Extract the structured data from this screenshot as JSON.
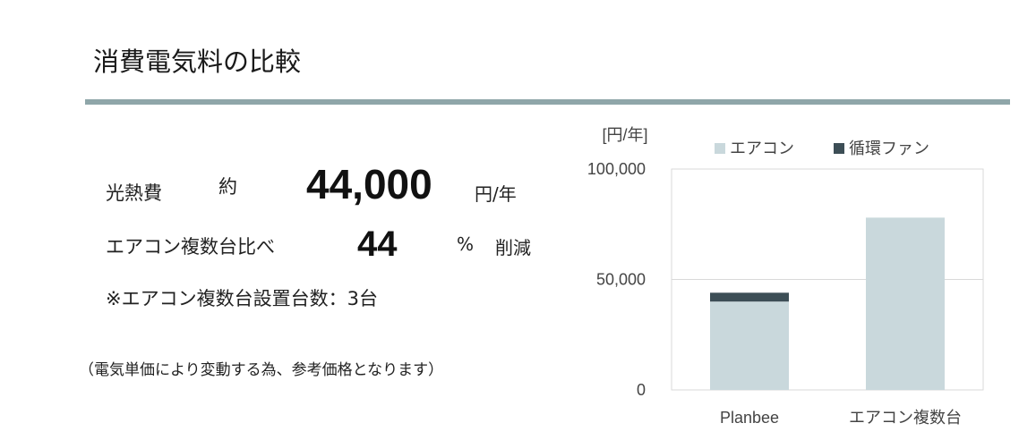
{
  "title": "消費電気料の比較",
  "summary": {
    "cost_label": "光熱費",
    "approx_label": "約",
    "cost_value": "44,000",
    "cost_unit": "円/年",
    "compare_label": "エアコン複数台比べ",
    "reduction_value": "44",
    "percent_sign": "%",
    "reduction_label": "削減",
    "note": "※エアコン複数台設置台数：3台"
  },
  "footnote": "（電気単価により変動する為、参考価格となります）",
  "colors": {
    "rule": "#8fa6a9",
    "aircon": "#c9d8dc",
    "fan": "#3d4e56",
    "grid": "#d9d9d9"
  },
  "chart_data": {
    "type": "bar",
    "stacked": true,
    "ylabel": "[円/年]",
    "ylim": [
      0,
      100000
    ],
    "yticks": [
      "0",
      "50,000",
      "100,000"
    ],
    "categories": [
      "Planbee",
      "エアコン複数台"
    ],
    "series": [
      {
        "name": "エアコン",
        "values": [
          40000,
          78000
        ]
      },
      {
        "name": "循環ファン",
        "values": [
          4000,
          0
        ]
      }
    ],
    "legend": "top",
    "grid": true
  }
}
